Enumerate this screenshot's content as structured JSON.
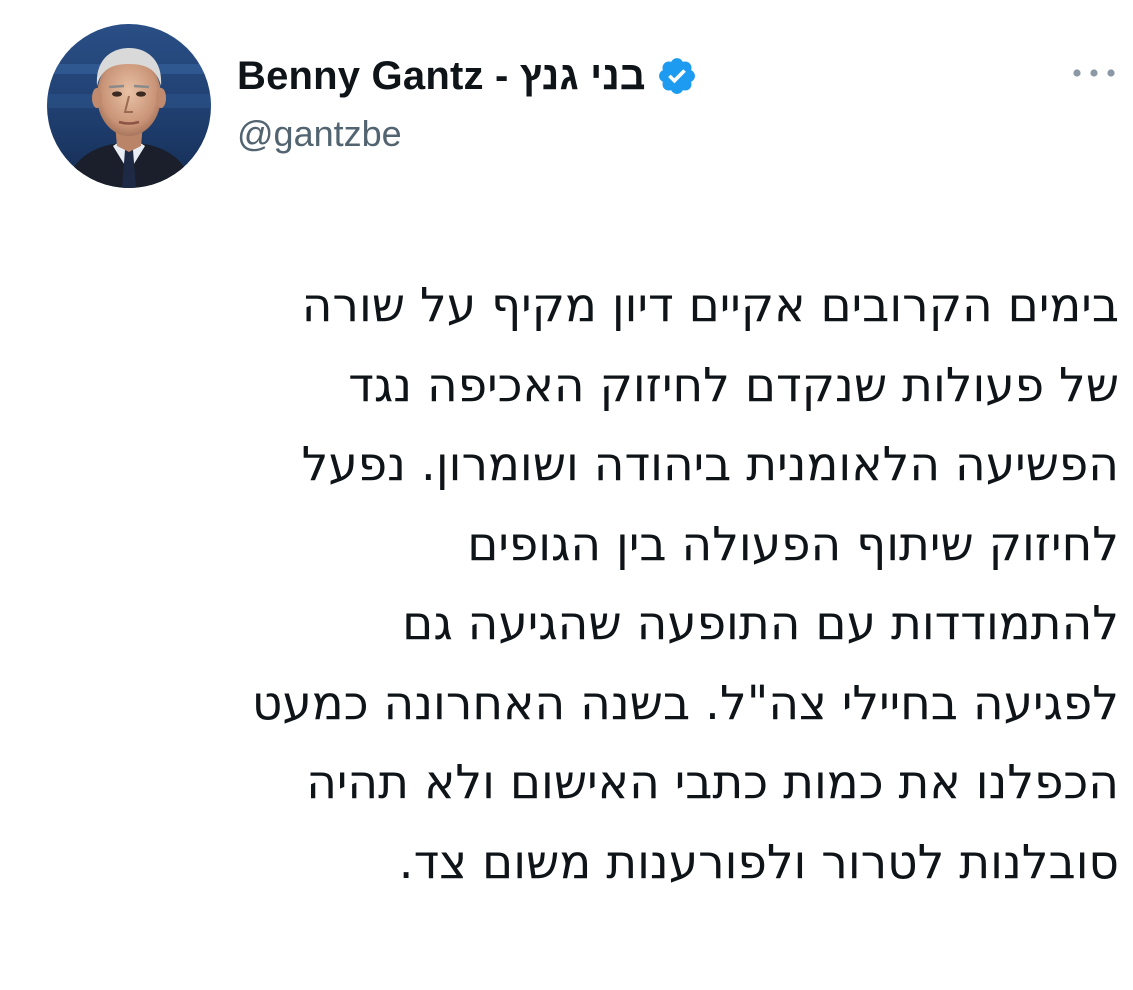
{
  "author": {
    "display_name": "Benny Gantz - בני גנץ",
    "handle": "@gantzbe",
    "verified": true,
    "avatar_icon": "profile-photo",
    "verified_icon": "verified-badge-icon",
    "more_icon": "more-options-icon"
  },
  "tweet": {
    "lines": [
      "בימים הקרובים אקיים דיון מקיף על שורה",
      "של פעולות שנקדם לחיזוק האכיפה נגד",
      "הפשיעה הלאומנית ביהודה ושומרון. נפעל",
      "לחיזוק שיתוף הפעולה בין הגופים",
      "להתמודדות עם התופעה שהגיעה גם",
      "לפגיעה בחיילי צה\"ל. בשנה האחרונה כמעט",
      "הכפלנו את כמות כתבי האישום ולא תהיה",
      "סובלנות לטרור ולפורענות משום צד."
    ]
  },
  "colors": {
    "text_primary": "#0f1419",
    "text_secondary": "#536471",
    "verified_blue": "#1d9bf0",
    "background": "#ffffff"
  }
}
